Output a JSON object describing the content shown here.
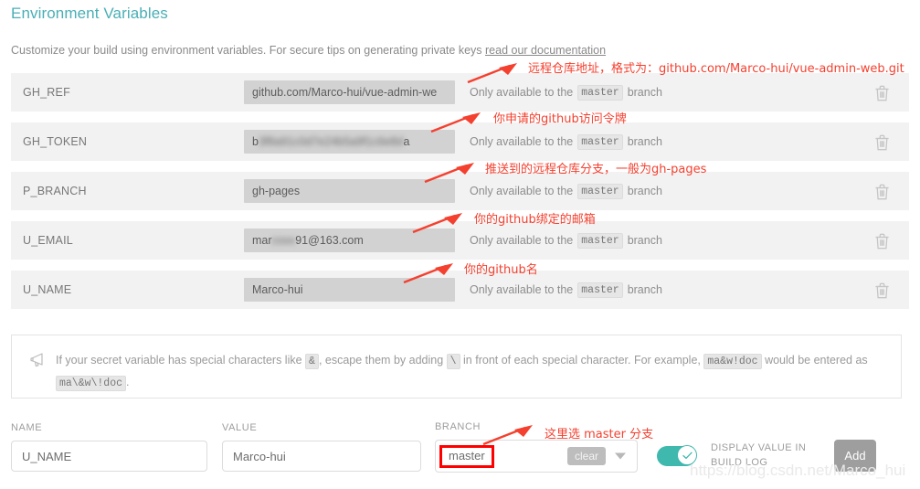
{
  "page": {
    "title": "Environment Variables",
    "description_prefix": "Customize your build using environment variables. For secure tips on generating private keys ",
    "description_link": "read our documentation"
  },
  "env_vars": [
    {
      "name": "GH_REF",
      "value": "github.com/Marco-hui/vue-admin-we",
      "value_masked": false,
      "branch_prefix": "Only available to the",
      "branch_chip": "master",
      "branch_suffix": "branch",
      "delete_icon": "trash-icon",
      "annotation": "远程仓库地址，格式为：github.com/Marco-hui/vue-admin-web.git"
    },
    {
      "name": "GH_TOKEN",
      "value_prefix": "b",
      "value_masked_text": "3f8a91c0d7e24b5a9f1c6e8d",
      "value_suffix": "a",
      "value_masked": true,
      "branch_prefix": "Only available to the",
      "branch_chip": "master",
      "branch_suffix": "branch",
      "delete_icon": "trash-icon",
      "annotation": "你申请的github访问令牌"
    },
    {
      "name": "P_BRANCH",
      "value": "gh-pages",
      "value_masked": false,
      "branch_prefix": "Only available to the",
      "branch_chip": "master",
      "branch_suffix": "branch",
      "delete_icon": "trash-icon",
      "annotation": "推送到的远程仓库分支，一般为gh-pages"
    },
    {
      "name": "U_EMAIL",
      "value_prefix": "mar",
      "value_masked_text": "coxx",
      "value_suffix": "91@163.com",
      "value_masked": true,
      "branch_prefix": "Only available to the",
      "branch_chip": "master",
      "branch_suffix": "branch",
      "delete_icon": "trash-icon",
      "annotation": "你的github绑定的邮箱"
    },
    {
      "name": "U_NAME",
      "value": "Marco-hui",
      "value_masked": false,
      "branch_prefix": "Only available to the",
      "branch_chip": "master",
      "branch_suffix": "branch",
      "delete_icon": "trash-icon",
      "annotation": "你的github名"
    }
  ],
  "tip": {
    "icon": "megaphone-icon",
    "part1": "If your secret variable has special characters like",
    "chip1": "&",
    "part2": ", escape them by adding",
    "chip2": "\\",
    "part3": "in front of each special character. For example,",
    "chip3": "ma&w!doc",
    "part4": "would be entered as",
    "chip4": "ma\\&w\\!doc",
    "part5": "."
  },
  "form": {
    "name_label": "NAME",
    "name_value": "U_NAME",
    "value_label": "VALUE",
    "value_value": "Marco-hui",
    "branch_label": "BRANCH",
    "branch_value": "master",
    "clear_label": "clear",
    "caret_icon": "chevron-down-icon",
    "toggle_state": "on",
    "toggle_icon": "check-icon",
    "display_label": "DISPLAY VALUE IN BUILD LOG",
    "add_label": "Add",
    "branch_annotation": "这里选 master 分支"
  },
  "watermark": "https://blog.csdn.net/Marco_hui",
  "colors": {
    "heading": "#4aafb6",
    "annotation": "#f4402f",
    "toggle_on": "#3fb8ae",
    "row_bg": "#f2f2f2",
    "value_bg": "#d2d2d2"
  }
}
